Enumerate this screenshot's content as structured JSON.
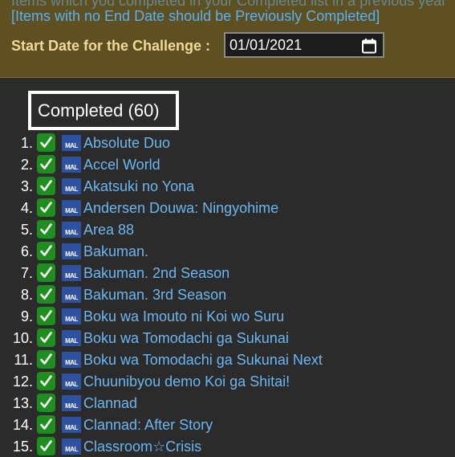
{
  "header": {
    "note_partial": "Items which you completed in your Completed list in a previous year",
    "note": "[Items with no End Date should be Previously Completed]",
    "start_date_label": "Start Date for the Challenge :",
    "start_date_value": "01/01/2021"
  },
  "section": {
    "title": "Completed (60)"
  },
  "icons": {
    "check": "check-mark-icon",
    "mal": "myanimelist-icon",
    "mal_text": "MAL",
    "calendar": "calendar-icon"
  },
  "colors": {
    "link": "#6cb6f0",
    "check_bg": "#1e8e1e",
    "mal_bg": "#2e51a2",
    "panel_bg": "#5e5020"
  },
  "items": [
    {
      "num": "1.",
      "title": "Absolute Duo"
    },
    {
      "num": "2.",
      "title": "Accel World"
    },
    {
      "num": "3.",
      "title": "Akatsuki no Yona"
    },
    {
      "num": "4.",
      "title": "Andersen Douwa: Ningyohime"
    },
    {
      "num": "5.",
      "title": "Area 88"
    },
    {
      "num": "6.",
      "title": "Bakuman."
    },
    {
      "num": "7.",
      "title": "Bakuman. 2nd Season"
    },
    {
      "num": "8.",
      "title": "Bakuman. 3rd Season"
    },
    {
      "num": "9.",
      "title": "Boku wa Imouto ni Koi wo Suru"
    },
    {
      "num": "10.",
      "title": "Boku wa Tomodachi ga Sukunai"
    },
    {
      "num": "11.",
      "title": "Boku wa Tomodachi ga Sukunai Next"
    },
    {
      "num": "12.",
      "title": "Chuunibyou demo Koi ga Shitai!"
    },
    {
      "num": "13.",
      "title": "Clannad"
    },
    {
      "num": "14.",
      "title": "Clannad: After Story"
    },
    {
      "num": "15.",
      "title": "Classroom☆Crisis"
    }
  ]
}
